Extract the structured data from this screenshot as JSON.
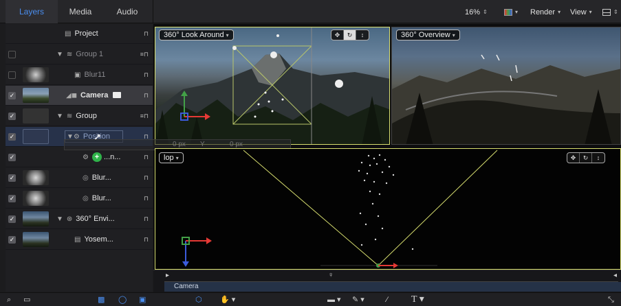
{
  "panel_tabs": [
    {
      "label": "Layers",
      "active": true
    },
    {
      "label": "Media",
      "active": false
    },
    {
      "label": "Audio",
      "active": false
    }
  ],
  "toolbar": {
    "zoom": "16%",
    "render_label": "Render",
    "view_label": "View"
  },
  "layers": {
    "project_label": "Project",
    "rows": [
      {
        "label": "Group 1",
        "kind": "group",
        "checked": false
      },
      {
        "label": "Blur11",
        "kind": "filter",
        "checked": false
      },
      {
        "label": "Camera",
        "kind": "camera",
        "checked": true
      },
      {
        "label": "Group",
        "kind": "group",
        "checked": true
      },
      {
        "label": "Position",
        "kind": "behavior",
        "checked": true
      },
      {
        "label": "...n...",
        "kind": "effect",
        "checked": true
      },
      {
        "label": "Blur...",
        "kind": "filter",
        "checked": true
      },
      {
        "label": "Blur...",
        "kind": "filter",
        "checked": true
      },
      {
        "label": "360° Envi...",
        "kind": "environment",
        "checked": true
      },
      {
        "label": "Yosem...",
        "kind": "clip",
        "checked": true
      }
    ]
  },
  "viewports": {
    "left_mode": "360° Look Around",
    "right_mode": "360° Overview",
    "bottom_mode": "Top",
    "bottom_mode_display": "lop",
    "drag_readout": {
      "x": "0 px",
      "y_label": "Y",
      "y": "0 px"
    }
  },
  "timeline": {
    "track_label": "Camera"
  },
  "colors": {
    "accent": "#4a8ef0",
    "viewport_border": "#d9e070",
    "axis_x": "#e53935",
    "axis_y": "#43a047",
    "axis_z": "#3b5bdb"
  }
}
